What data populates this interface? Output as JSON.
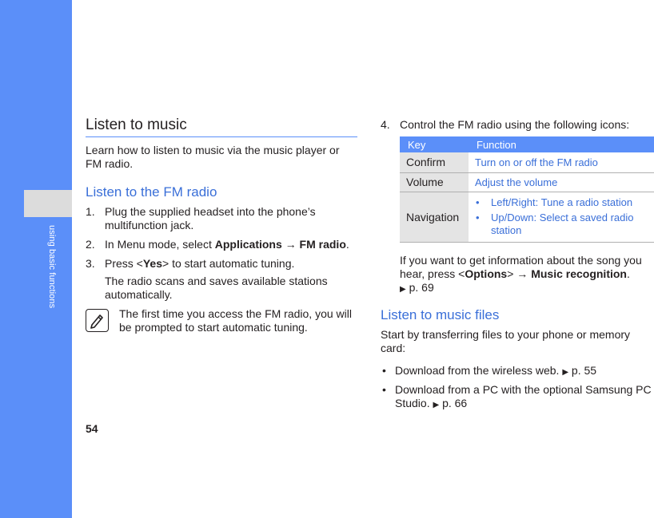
{
  "sidebar": {
    "label": "using basic functions"
  },
  "page_number": "54",
  "left": {
    "title": "Listen to music",
    "intro": "Learn how to listen to music via the music player or FM radio.",
    "fm_heading": "Listen to the FM radio",
    "step1": {
      "num": "1.",
      "text": "Plug the supplied headset into the phone’s multifunction jack."
    },
    "step2": {
      "num": "2.",
      "pre": "In Menu mode, select ",
      "b1": "Applications",
      "arrow": " → ",
      "b2": "FM radio",
      "post": "."
    },
    "step3": {
      "num": "3.",
      "pre": "Press <",
      "key": "Yes",
      "post": "> to start automatic tuning.",
      "extra": "The radio scans and saves available stations automatically."
    },
    "note": "The first time you access the FM radio, you will be prompted to start automatic tuning."
  },
  "right": {
    "step4": {
      "num": "4.",
      "text": "Control the FM radio using the following icons:"
    },
    "table": {
      "headers": [
        "Key",
        "Function"
      ],
      "confirm_key": "Confirm",
      "confirm_fn": "Turn on or off the FM radio",
      "volume_key": "Volume",
      "volume_fn": "Adjust the volume",
      "nav_key": "Navigation",
      "nav_fn1": "Left/Right: Tune a radio station",
      "nav_fn2": "Up/Down: Select a saved radio station"
    },
    "after": {
      "pre": "If you want to get information about the song you hear, press <",
      "b1": "Options",
      "mid": "> → ",
      "b2": "Music recognition",
      "post": ".",
      "ref": "p. 69"
    },
    "files_heading": "Listen to music files",
    "files_intro": "Start by transferring files to your phone or memory card:",
    "bullet1": {
      "text": "Download from the wireless web. ",
      "ref": "p. 55"
    },
    "bullet2": {
      "text": "Download from a PC with the optional Samsung PC Studio. ",
      "ref": "p. 66"
    }
  },
  "colors": {
    "accent": "#5b8ff9",
    "heading_blue": "#3a6fd8",
    "tab_gray": "#dcdcdc"
  },
  "icons": {
    "note": "pencil-note-icon",
    "ref": "triangle-right-icon"
  }
}
